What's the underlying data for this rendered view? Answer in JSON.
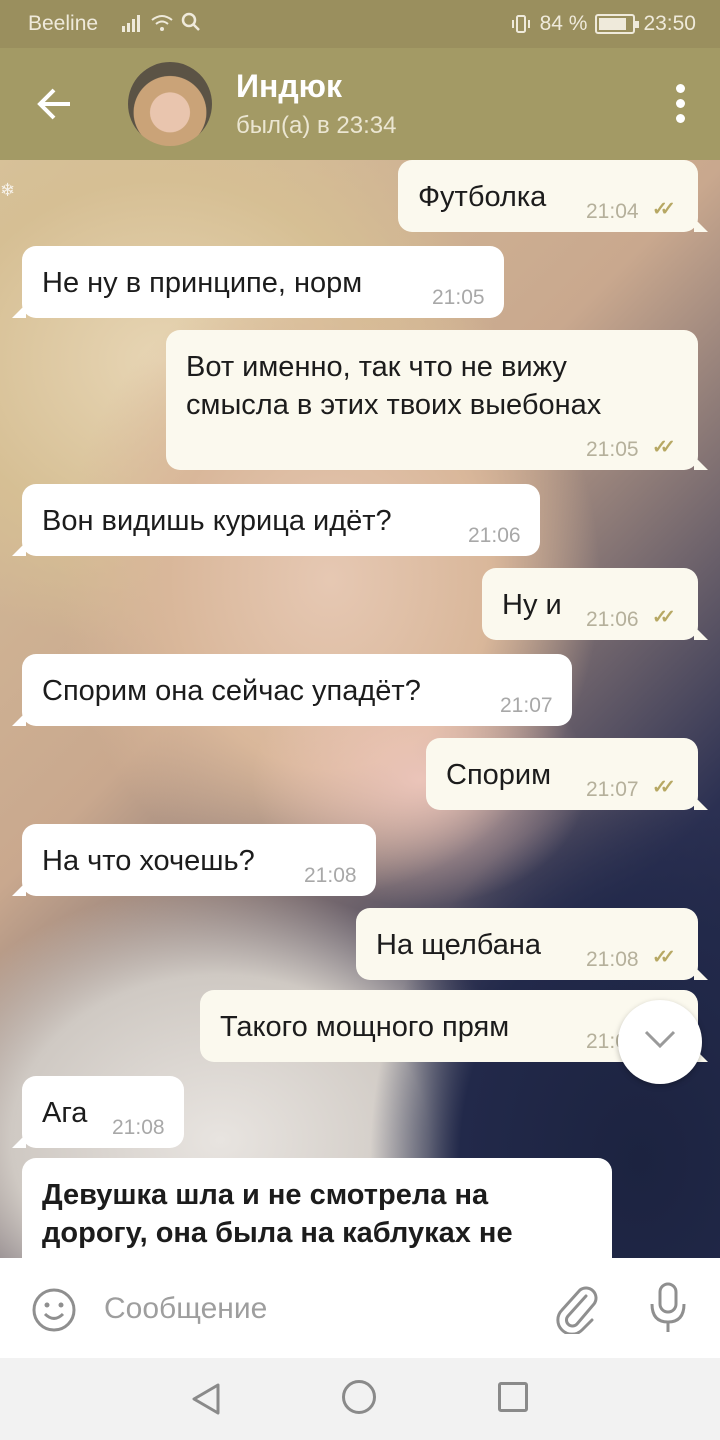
{
  "status": {
    "carrier": "Beeline",
    "signal": "...",
    "battery_text": "84 %",
    "battery_level": 0.84,
    "time": "23:50"
  },
  "header": {
    "title": "Индюк",
    "subtitle": "был(а) в 23:34"
  },
  "messages": [
    {
      "dir": "out",
      "text": "Футболка",
      "time": "21:04",
      "read": true
    },
    {
      "dir": "in",
      "text": "Не ну в принципе, норм",
      "time": "21:05"
    },
    {
      "dir": "out",
      "text": "Вот именно, так что не вижу\nсмысла в этих твоих выебонах",
      "time": "21:05",
      "read": true
    },
    {
      "dir": "in",
      "text": "Вон видишь курица идёт?",
      "time": "21:06"
    },
    {
      "dir": "out",
      "text": "Ну и",
      "time": "21:06",
      "read": true
    },
    {
      "dir": "in",
      "text": "Спорим она сейчас упадёт?",
      "time": "21:07"
    },
    {
      "dir": "out",
      "text": "Спорим",
      "time": "21:07",
      "read": true
    },
    {
      "dir": "in",
      "text": "На что хочешь?",
      "time": "21:08"
    },
    {
      "dir": "out",
      "text": "На щелбана",
      "time": "21:08",
      "read": true
    },
    {
      "dir": "out",
      "text": "Такого мощного прям",
      "time": "21:08",
      "read": true
    },
    {
      "dir": "in",
      "text": "Ага",
      "time": "21:08"
    },
    {
      "dir": "in",
      "text": "Девушка шла и не смотрела на\nдорогу, она была на каблуках не",
      "time": ""
    }
  ],
  "input": {
    "placeholder": "Сообщение"
  },
  "colors": {
    "header": "#a39a65",
    "status_bar": "#9a8f5e",
    "incoming_bubble": "#ffffff",
    "outgoing_bubble": "#fbf9ee",
    "read_ticks": "#b7a864"
  },
  "icons": {
    "back": "arrow-left-icon",
    "menu": "more-vertical-icon",
    "scroll_down": "chevron-down-icon",
    "emoji": "smile-icon",
    "attach": "paperclip-icon",
    "mic": "microphone-icon"
  }
}
